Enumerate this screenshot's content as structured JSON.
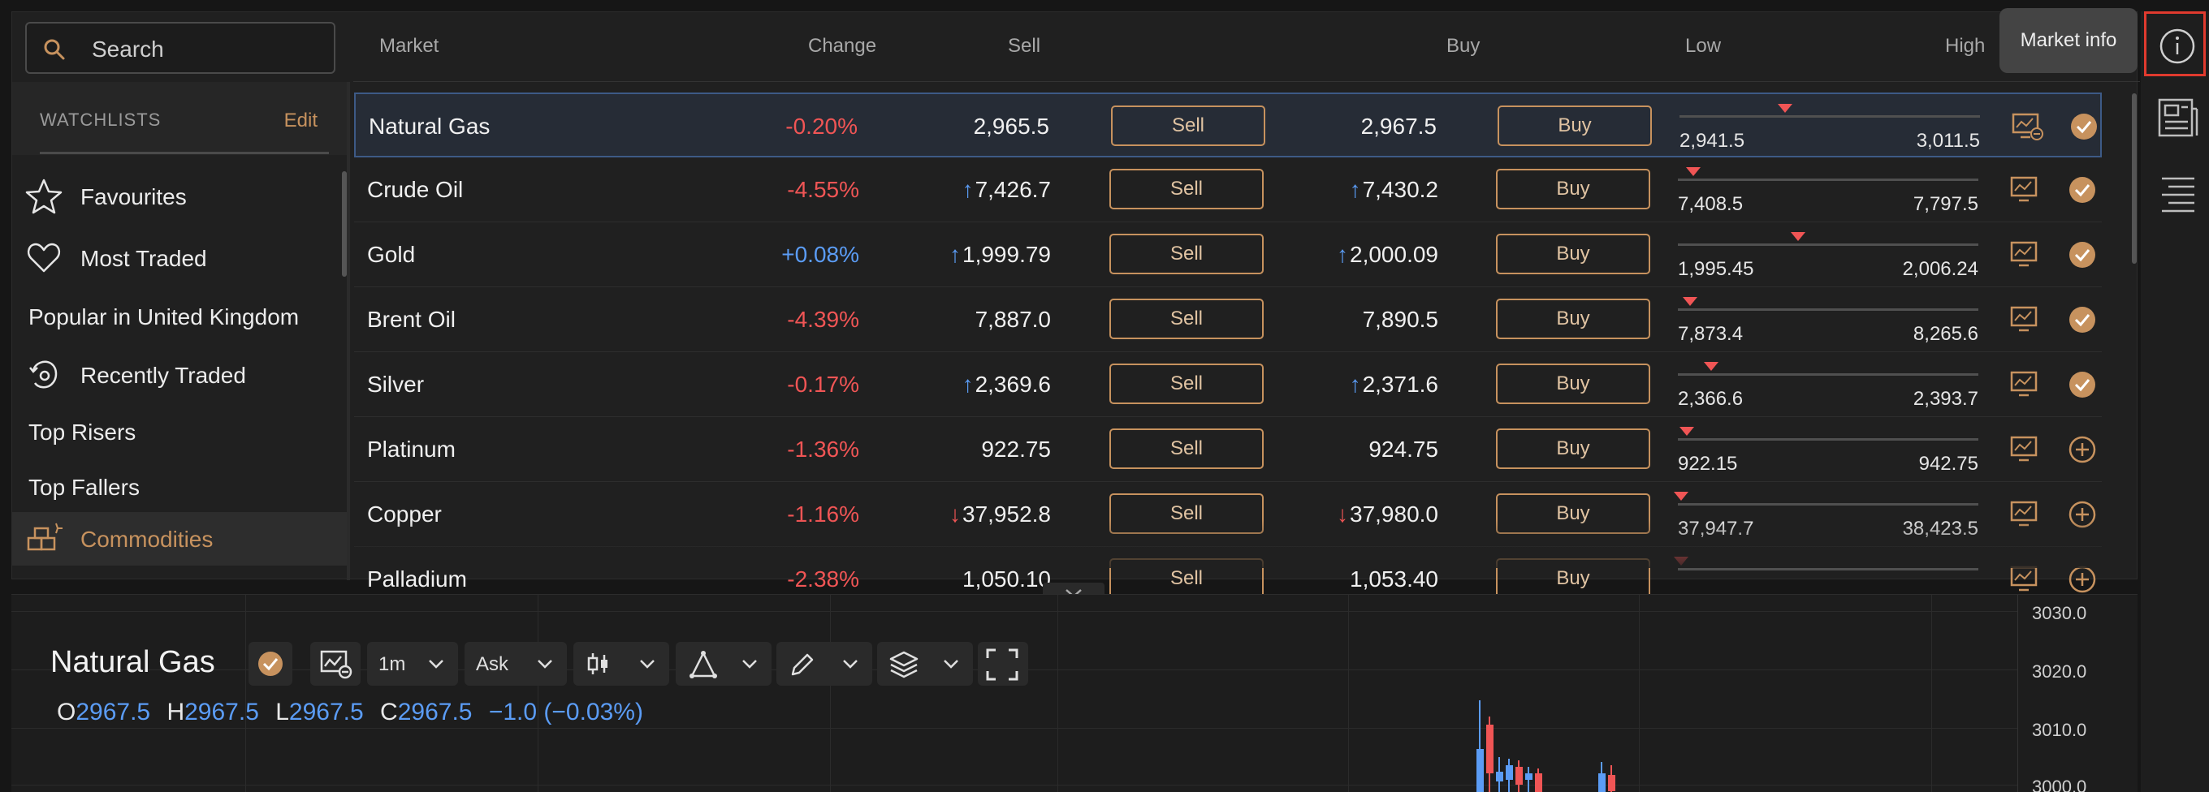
{
  "search": {
    "placeholder": "Search"
  },
  "header": {
    "market": "Market",
    "change": "Change",
    "sell": "Sell",
    "buy": "Buy",
    "low": "Low",
    "high": "High"
  },
  "watchlists": {
    "title": "WATCHLISTS",
    "edit": "Edit",
    "items": [
      {
        "label": "Favourites",
        "icon": "star-icon"
      },
      {
        "label": "Most Traded",
        "icon": "heart-icon"
      },
      {
        "label": "Popular in United Kingdom",
        "icon": ""
      },
      {
        "label": "Recently Traded",
        "icon": "recent-icon"
      },
      {
        "label": "Top Risers",
        "icon": ""
      },
      {
        "label": "Top Fallers",
        "icon": ""
      },
      {
        "label": "Commodities",
        "icon": "commodities-icon"
      }
    ]
  },
  "markets": [
    {
      "name": "Natural Gas",
      "change": "-0.20%",
      "sell": "2,965.5",
      "sell_dir": "",
      "sell_btn": "Sell",
      "buy": "2,967.5",
      "buy_dir": "",
      "buy_btn": "Buy",
      "low": "2,941.5",
      "high": "3,011.5",
      "range_pos": 0.35,
      "status": "added"
    },
    {
      "name": "Crude Oil",
      "change": "-4.55%",
      "sell": "7,426.7",
      "sell_dir": "up",
      "sell_btn": "Sell",
      "buy": "7,430.2",
      "buy_dir": "up",
      "buy_btn": "Buy",
      "low": "7,408.5",
      "high": "7,797.5",
      "range_pos": 0.05,
      "status": "added"
    },
    {
      "name": "Gold",
      "change": "+0.08%",
      "sell": "1,999.79",
      "sell_dir": "up",
      "sell_btn": "Sell",
      "buy": "2,000.09",
      "buy_dir": "up",
      "buy_btn": "Buy",
      "low": "1,995.45",
      "high": "2,006.24",
      "range_pos": 0.4,
      "status": "added"
    },
    {
      "name": "Brent Oil",
      "change": "-4.39%",
      "sell": "7,887.0",
      "sell_dir": "",
      "sell_btn": "Sell",
      "buy": "7,890.5",
      "buy_dir": "",
      "buy_btn": "Buy",
      "low": "7,873.4",
      "high": "8,265.6",
      "range_pos": 0.04,
      "status": "added"
    },
    {
      "name": "Silver",
      "change": "-0.17%",
      "sell": "2,369.6",
      "sell_dir": "up",
      "sell_btn": "Sell",
      "buy": "2,371.6",
      "buy_dir": "up",
      "buy_btn": "Buy",
      "low": "2,366.6",
      "high": "2,393.7",
      "range_pos": 0.11,
      "status": "added"
    },
    {
      "name": "Platinum",
      "change": "-1.36%",
      "sell": "922.75",
      "sell_dir": "",
      "sell_btn": "Sell",
      "buy": "924.75",
      "buy_dir": "",
      "buy_btn": "Buy",
      "low": "922.15",
      "high": "942.75",
      "range_pos": 0.03,
      "status": "add"
    },
    {
      "name": "Copper",
      "change": "-1.16%",
      "sell": "37,952.8",
      "sell_dir": "down",
      "sell_btn": "Sell",
      "buy": "37,980.0",
      "buy_dir": "down",
      "buy_btn": "Buy",
      "low": "37,947.7",
      "high": "38,423.5",
      "range_pos": 0.01,
      "status": "add"
    },
    {
      "name": "Palladium",
      "change": "-2.38%",
      "sell": "1,050.10",
      "sell_dir": "",
      "sell_btn": "Sell",
      "buy": "1,053.40",
      "buy_dir": "",
      "buy_btn": "Buy",
      "low": "",
      "high": "",
      "range_pos": 0.01,
      "status": "add"
    }
  ],
  "rail": {
    "tooltip": "Market info"
  },
  "chart": {
    "title": "Natural Gas",
    "interval": "1m",
    "price_type": "Ask",
    "ohlc": {
      "o_label": "O",
      "o": "2967.5",
      "h_label": "H",
      "h": "2967.5",
      "l_label": "L",
      "l": "2967.5",
      "c_label": "C",
      "c": "2967.5",
      "change": "−1.0 (−0.03%)"
    },
    "y_ticks": [
      "3030.0",
      "3020.0",
      "3010.0",
      "3000.0"
    ]
  },
  "colors": {
    "accent": "#c7925e",
    "negative": "#f05555",
    "positive": "#5b9cf5",
    "highlight": "#e03a2e"
  }
}
